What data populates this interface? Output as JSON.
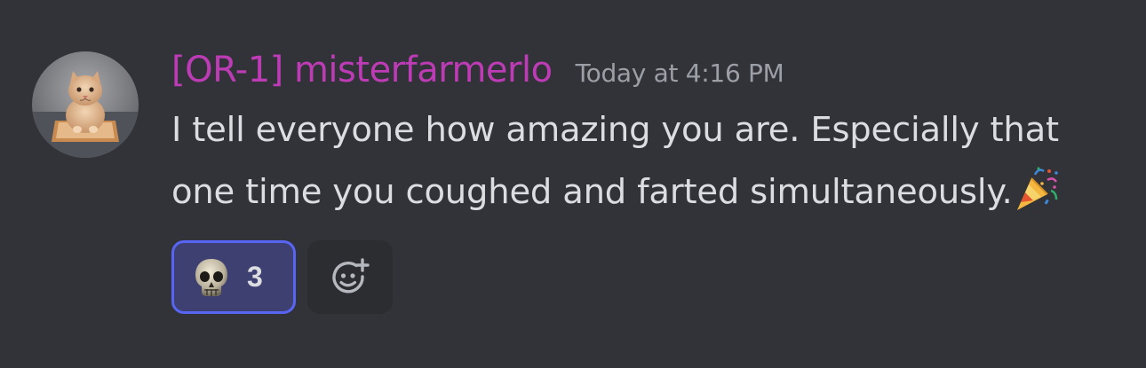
{
  "message": {
    "author": "[OR-1] misterfarmerlo",
    "timestamp": "Today at 4:16 PM",
    "content_line_1": "I tell everyone how amazing you are. Especially that",
    "content_line_2": "one time you coughed and farted simultaneously.",
    "trailing_emoji": "party-popper",
    "author_color": "#bd3bb5"
  },
  "reactions": [
    {
      "emoji": "skull",
      "count": "3",
      "reacted_by_me": true
    }
  ],
  "add_reaction": {
    "icon": "add-reaction-icon"
  }
}
